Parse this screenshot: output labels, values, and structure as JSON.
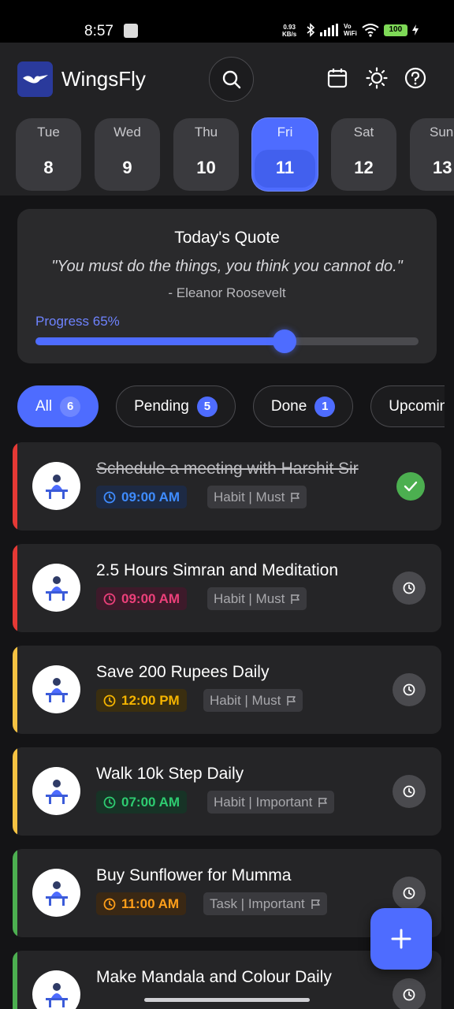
{
  "status_bar": {
    "time": "8:57",
    "speed": "0.93",
    "speed_unit": "KB/s",
    "network_label_top": "Vo",
    "network_label_bottom": "WiFi",
    "battery": "100"
  },
  "header": {
    "app_title": "WingsFly"
  },
  "days": [
    {
      "name": "Tue",
      "num": "8",
      "active": false
    },
    {
      "name": "Wed",
      "num": "9",
      "active": false
    },
    {
      "name": "Thu",
      "num": "10",
      "active": false
    },
    {
      "name": "Fri",
      "num": "11",
      "active": true
    },
    {
      "name": "Sat",
      "num": "12",
      "active": false
    },
    {
      "name": "Sun",
      "num": "13",
      "active": false
    }
  ],
  "quote": {
    "title": "Today's Quote",
    "text": "\"You must do the things, you think you cannot do.\"",
    "author": "- Eleanor Roosevelt",
    "progress_label": "Progress 65%",
    "progress": 0.65
  },
  "filters": [
    {
      "label": "All",
      "count": "6",
      "active": true
    },
    {
      "label": "Pending",
      "count": "5",
      "active": false
    },
    {
      "label": "Done",
      "count": "1",
      "active": false
    },
    {
      "label": "Upcoming",
      "count": "",
      "active": false
    }
  ],
  "tasks": [
    {
      "title": "Schedule a meeting with Harshit Sir",
      "time": "09:00 AM",
      "tag": "Habit | Must",
      "done": true,
      "accent": "#e53935",
      "time_color": "#3f8cff",
      "time_bg": "#1d2a44"
    },
    {
      "title": "2.5 Hours Simran and Meditation",
      "time": "09:00 AM",
      "tag": "Habit | Must",
      "done": false,
      "accent": "#e53935",
      "time_color": "#ec407a",
      "time_bg": "#3d1a2a"
    },
    {
      "title": "Save 200 Rupees Daily",
      "time": "12:00 PM",
      "tag": "Habit | Must",
      "done": false,
      "accent": "#f5c242",
      "time_color": "#f5b400",
      "time_bg": "#3a2e10"
    },
    {
      "title": "Walk 10k Step Daily",
      "time": "07:00 AM",
      "tag": "Habit | Important",
      "done": false,
      "accent": "#f5c242",
      "time_color": "#2ecc71",
      "time_bg": "#173326"
    },
    {
      "title": "Buy Sunflower for Mumma",
      "time": "11:00 AM",
      "tag": "Task | Important",
      "done": false,
      "accent": "#4caf50",
      "time_color": "#ff9f1a",
      "time_bg": "#3a2814"
    },
    {
      "title": "Make Mandala and Colour Daily",
      "time": "",
      "tag": "",
      "done": false,
      "accent": "#4caf50",
      "time_color": "#3f8cff",
      "time_bg": "#1d2a44"
    }
  ],
  "colors": {
    "accent": "#4e6cff",
    "background": "#141416",
    "card": "#252527"
  },
  "icons": [
    "search-icon",
    "calendar-icon",
    "brightness-icon",
    "help-icon",
    "clock-icon",
    "flag-icon",
    "check-icon",
    "plus-icon"
  ]
}
